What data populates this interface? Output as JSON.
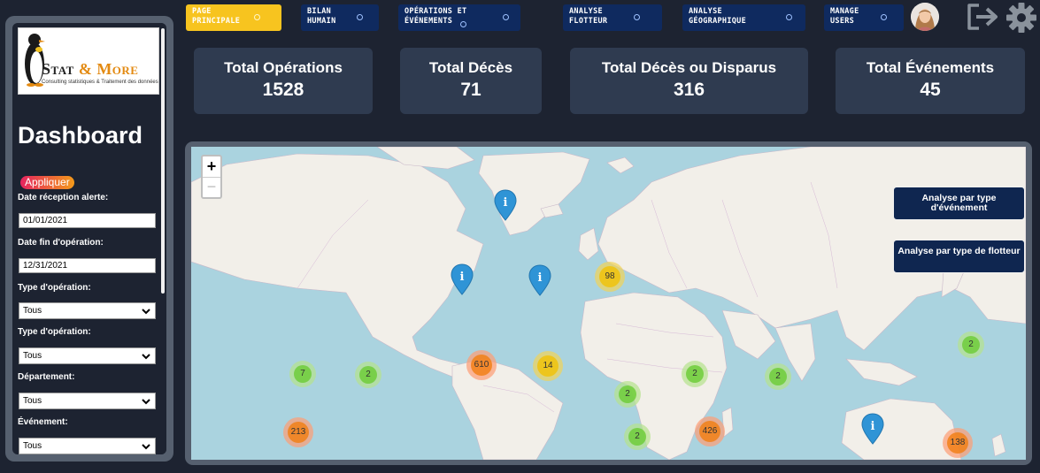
{
  "colors": {
    "background": "#1d2331",
    "card": "#2f3b50",
    "nav": "#0f2a5f",
    "nav_active": "#f7c41f",
    "ocean": "#aad3df",
    "land": "#f2efe9",
    "cluster_green": "#6ecc39",
    "cluster_yellow": "#f0c20c",
    "cluster_orange": "#f18017"
  },
  "nav": [
    {
      "line1": "PAGE",
      "line2": "PRINCIPALE",
      "active": true
    },
    {
      "line1": "BILAN",
      "line2": "HUMAIN",
      "active": false
    },
    {
      "line1": "OPÉRATIONS ET",
      "line2": "ÉVÉNEMENTS",
      "active": false
    },
    {
      "line1": "ANALYSE",
      "line2": "FLOTTEUR",
      "active": false
    },
    {
      "line1": "ANALYSE",
      "line2": "GÉOGRAPHIQUE",
      "active": false
    },
    {
      "line1": "MANAGE",
      "line2": "USERS",
      "active": false
    }
  ],
  "header_icons": {
    "avatar": "user-avatar",
    "logout": "logout-icon",
    "settings": "gear-icon"
  },
  "sidebar": {
    "logo_line1": "Stat",
    "logo_amp": "&",
    "logo_line2": "More",
    "logo_tagline": "Consulting statistiques & Traitement des données",
    "title": "Dashboard",
    "apply": "Appliquer",
    "filters": [
      {
        "label": "Date réception alerte:",
        "type": "date",
        "value": "01/01/2021"
      },
      {
        "label": "Date fin d'opération:",
        "type": "date",
        "value": "12/31/2021"
      },
      {
        "label": "Type d'opération:",
        "type": "select",
        "value": "Tous"
      },
      {
        "label": "Type d'opération:",
        "type": "select",
        "value": "Tous"
      },
      {
        "label": "Département:",
        "type": "select",
        "value": "Tous"
      },
      {
        "label": "Événement:",
        "type": "select",
        "value": "Tous"
      }
    ]
  },
  "kpis": [
    {
      "label": "Total Opérations",
      "value": "1528"
    },
    {
      "label": "Total Décès",
      "value": "71"
    },
    {
      "label": "Total Décès ou Disparus",
      "value": "316"
    },
    {
      "label": "Total Événements",
      "value": "45"
    }
  ],
  "map": {
    "zoom_in": "+",
    "zoom_out": "−",
    "buttons": [
      "Analyse par type d'événement",
      "Analyse par type de flotteur"
    ],
    "clusters": [
      {
        "label": "98",
        "level": "yellow"
      },
      {
        "label": "7",
        "level": "green"
      },
      {
        "label": "2",
        "level": "green"
      },
      {
        "label": "610",
        "level": "orange"
      },
      {
        "label": "14",
        "level": "yellow"
      },
      {
        "label": "2",
        "level": "green"
      },
      {
        "label": "2",
        "level": "green"
      },
      {
        "label": "2",
        "level": "green"
      },
      {
        "label": "2",
        "level": "green"
      },
      {
        "label": "213",
        "level": "orange"
      },
      {
        "label": "2",
        "level": "green"
      },
      {
        "label": "426",
        "level": "orange"
      },
      {
        "label": "138",
        "level": "orange"
      }
    ],
    "info_markers": [
      "info-marker",
      "info-marker",
      "info-marker",
      "info-marker"
    ]
  }
}
